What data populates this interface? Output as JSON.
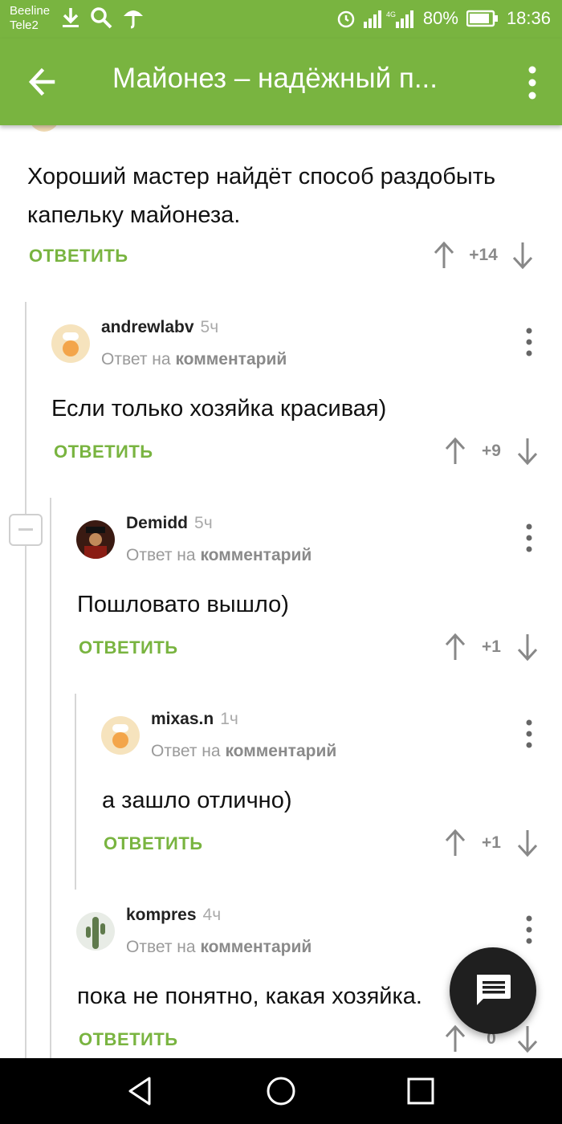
{
  "status_bar": {
    "carrier_1": "Beeline",
    "carrier_2": "Tele2",
    "battery": "80%",
    "time": "18:36",
    "network": "4G",
    "icons": [
      "download-icon",
      "search-icon",
      "umbrella-icon",
      "alarm-icon",
      "signal-icon",
      "battery-icon"
    ]
  },
  "app_bar": {
    "title": "Майонез – надёжный п...",
    "color": "#79b440"
  },
  "top_comment": {
    "text_line1": "Хороший мастер найдёт способ раздобыть",
    "text_line2": "капельку майонеза.",
    "reply_label": "ОТВЕТИТЬ",
    "score": "+14"
  },
  "comments": [
    {
      "author": "andrewlabv",
      "time": "5ч",
      "reply_prefix": "Ответ на",
      "reply_target": "комментарий",
      "text": "Если только хозяйка красивая)",
      "reply_label": "ОТВЕТИТЬ",
      "score": "+9"
    },
    {
      "author": "Demidd",
      "time": "5ч",
      "reply_prefix": "Ответ на",
      "reply_target": "комментарий",
      "text": "Пошловато вышло)",
      "reply_label": "ОТВЕТИТЬ",
      "score": "+1"
    },
    {
      "author": "mixas.n",
      "time": "1ч",
      "reply_prefix": "Ответ на",
      "reply_target": "комментарий",
      "text": "а зашло отлично)",
      "reply_label": "ОТВЕТИТЬ",
      "score": "+1"
    },
    {
      "author": "kompres",
      "time": "4ч",
      "reply_prefix": "Ответ на",
      "reply_target": "комментарий",
      "text": "пока не понятно, какая хозяйка.",
      "reply_label": "ОТВЕТИТЬ",
      "score": "0"
    }
  ]
}
